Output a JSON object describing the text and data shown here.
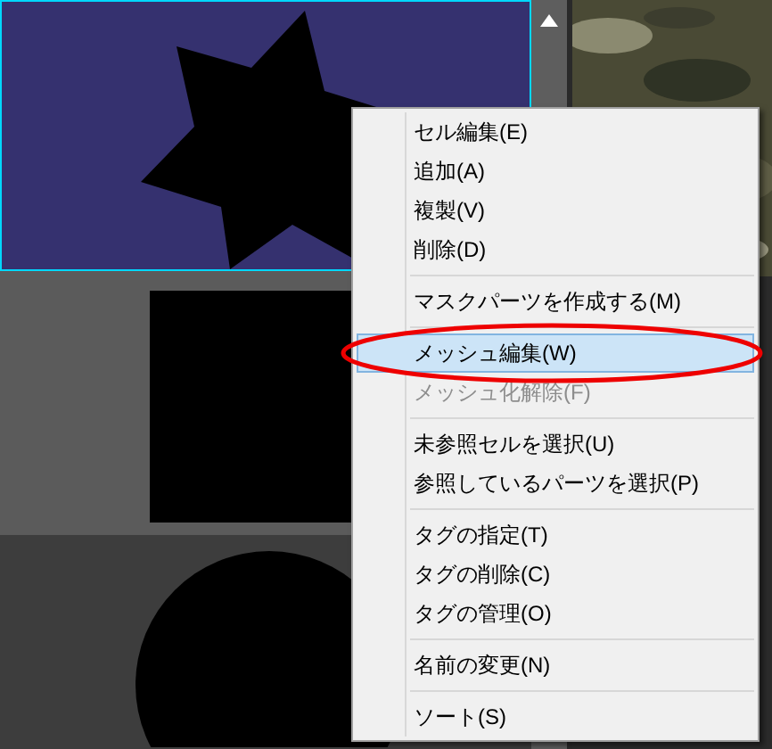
{
  "cells": [
    {
      "kind": "star",
      "selected": true
    },
    {
      "kind": "rect",
      "selected": false
    },
    {
      "kind": "circle",
      "selected": false
    }
  ],
  "context_menu": {
    "items": [
      {
        "kind": "item",
        "label": "セル編集(E)",
        "selected": false,
        "disabled": false
      },
      {
        "kind": "item",
        "label": "追加(A)",
        "selected": false,
        "disabled": false
      },
      {
        "kind": "item",
        "label": "複製(V)",
        "selected": false,
        "disabled": false
      },
      {
        "kind": "item",
        "label": "削除(D)",
        "selected": false,
        "disabled": false
      },
      {
        "kind": "separator"
      },
      {
        "kind": "item",
        "label": "マスクパーツを作成する(M)",
        "selected": false,
        "disabled": false
      },
      {
        "kind": "separator"
      },
      {
        "kind": "item",
        "label": "メッシュ編集(W)",
        "selected": true,
        "disabled": false
      },
      {
        "kind": "item",
        "label": "メッシュ化解除(F)",
        "selected": false,
        "disabled": true
      },
      {
        "kind": "separator"
      },
      {
        "kind": "item",
        "label": "未参照セルを選択(U)",
        "selected": false,
        "disabled": false
      },
      {
        "kind": "item",
        "label": "参照しているパーツを選択(P)",
        "selected": false,
        "disabled": false
      },
      {
        "kind": "separator"
      },
      {
        "kind": "item",
        "label": "タグの指定(T)",
        "selected": false,
        "disabled": false
      },
      {
        "kind": "item",
        "label": "タグの削除(C)",
        "selected": false,
        "disabled": false
      },
      {
        "kind": "item",
        "label": "タグの管理(O)",
        "selected": false,
        "disabled": false
      },
      {
        "kind": "separator"
      },
      {
        "kind": "item",
        "label": "名前の変更(N)",
        "selected": false,
        "disabled": false
      },
      {
        "kind": "separator"
      },
      {
        "kind": "item",
        "label": "ソート(S)",
        "selected": false,
        "disabled": false
      }
    ]
  }
}
